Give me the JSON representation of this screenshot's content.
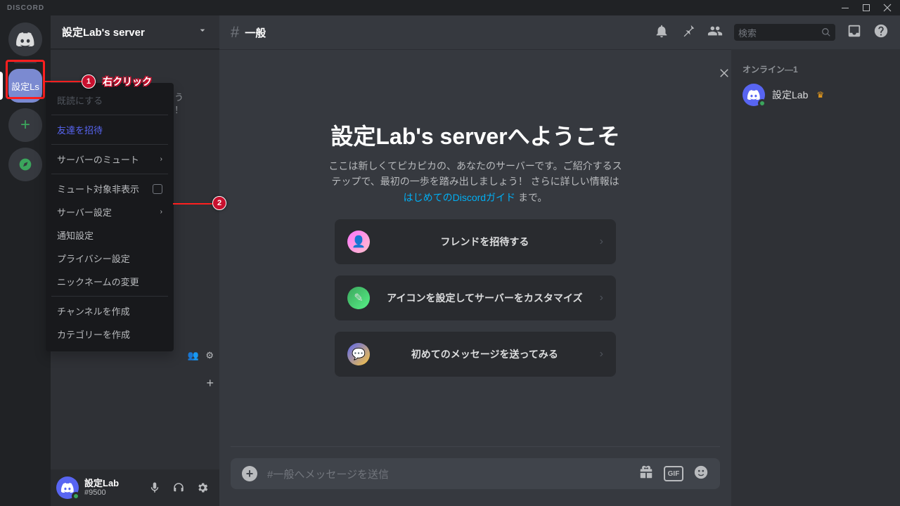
{
  "titlebar": {
    "logo": "DISCORD"
  },
  "server": {
    "name": "設定Lab's server",
    "selected_icon_label": "設定Ls"
  },
  "channel": {
    "current": "一般"
  },
  "user": {
    "name": "設定Lab",
    "tag": "#9500"
  },
  "toolbar": {
    "search_placeholder": "検索"
  },
  "welcome": {
    "title": "設定Lab's serverへようこそ",
    "subtitle_a": "ここは新しくてピカピカの、あなたのサーバーです。ご紹介するステップで、最初の一歩を踏み出しましょう！ さらに詳しい情報は ",
    "subtitle_link": "はじめてのDiscordガイド",
    "subtitle_b": " まで。"
  },
  "cards": {
    "c1": "フレンドを招待する",
    "c2": "アイコンを設定してサーバーをカスタマイズ",
    "c3": "初めてのメッセージを送ってみる"
  },
  "chatbar": {
    "placeholder": "#一般へメッセージを送信",
    "gif": "GIF"
  },
  "members": {
    "header": "オンライン—1",
    "m1": "設定Lab"
  },
  "ctx": {
    "mark_read": "既読にする",
    "invite": "友達を招待",
    "mute": "サーバーのミュート",
    "hide_muted": "ミュート対象非表示",
    "server_settings": "サーバー設定",
    "notif": "通知設定",
    "privacy": "プライバシー設定",
    "nickname": "ニックネームの変更",
    "create_channel": "チャンネルを作成",
    "create_category": "カテゴリーを作成"
  },
  "annot": {
    "n1": "1",
    "n2": "2",
    "t1": "右クリック"
  }
}
